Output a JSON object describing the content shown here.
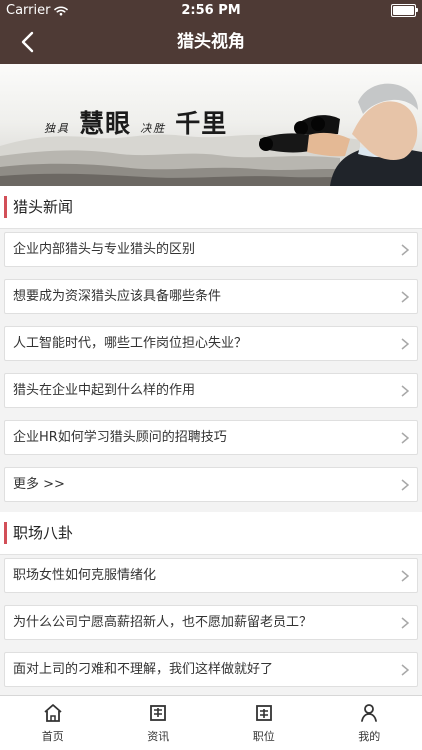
{
  "status_bar": {
    "carrier": "Carrier",
    "time": "2:56 PM",
    "battery_level": 1.0,
    "icons": [
      "wifi-icon",
      "battery-icon"
    ]
  },
  "navigation": {
    "title": "猎头视角",
    "back_icon": "back-chevron-icon"
  },
  "banner": {
    "slogan_small_1": "独具",
    "slogan_main_1": "慧眼",
    "slogan_small_2": "决胜",
    "slogan_main_2": "千里"
  },
  "sections": [
    {
      "title": "猎头新闻",
      "items": [
        "企业内部猎头与专业猎头的区别",
        "想要成为资深猎头应该具备哪些条件",
        "人工智能时代，哪些工作岗位担心失业？",
        "猎头在企业中起到什么样的作用",
        "企业HR如何学习猎头顾问的招聘技巧",
        "更多 >>"
      ]
    },
    {
      "title": "职场八卦",
      "items": [
        "职场女性如何克服情绪化",
        "为什么公司宁愿高薪招新人，也不愿加薪留老员工？",
        "面对上司的刁难和不理解，我们这样做就好了"
      ]
    }
  ],
  "tabbar": {
    "tabs": [
      {
        "label": "首页",
        "icon": "home-icon"
      },
      {
        "label": "资讯",
        "icon": "news-icon"
      },
      {
        "label": "职位",
        "icon": "jobs-icon"
      },
      {
        "label": "我的",
        "icon": "profile-icon"
      }
    ]
  },
  "colors": {
    "nav_background": "#4e3a35",
    "section_accent": "#d24f58",
    "page_background": "#f3f3f3"
  }
}
